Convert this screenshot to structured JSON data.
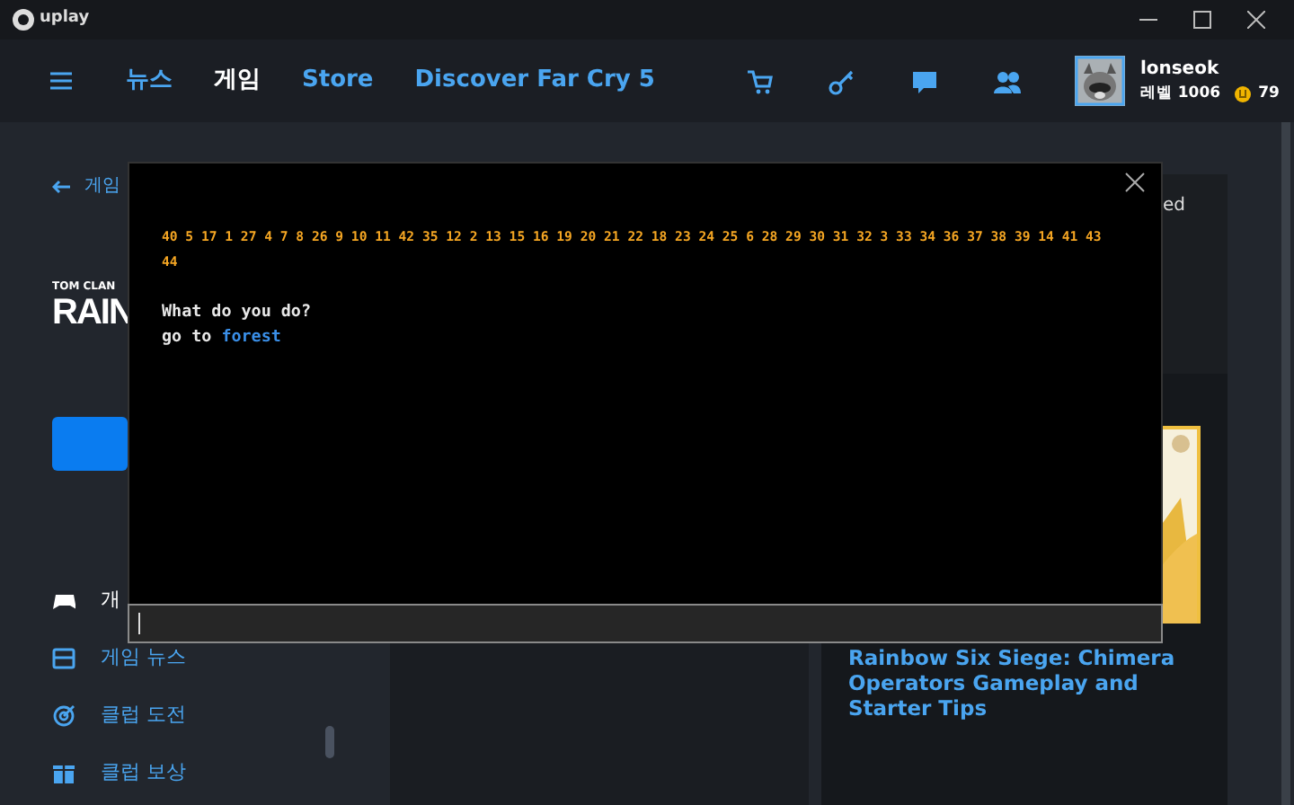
{
  "titlebar": {
    "logo": "uplay"
  },
  "nav": {
    "tabs": [
      {
        "label": "뉴스",
        "selected": false
      },
      {
        "label": "게임",
        "selected": true
      },
      {
        "label": "Store",
        "selected": false
      },
      {
        "label": "Discover Far Cry 5",
        "selected": false
      }
    ],
    "user": {
      "name": "lonseok",
      "level": "레벨 1006",
      "coins": "79"
    }
  },
  "sidebar": {
    "back": "게임",
    "logo_small": "TOM CLAN",
    "logo_big": "RAIN",
    "items": [
      {
        "label": "개",
        "selected": true
      },
      {
        "label": "게임 뉴스",
        "selected": false
      },
      {
        "label": "클럽 도전",
        "selected": false
      },
      {
        "label": "클럽 보상",
        "selected": false
      }
    ]
  },
  "right_panel": {
    "card_text": "ed",
    "article_title": "Rainbow Six Siege: Chimera Operators Gameplay and Starter Tips"
  },
  "console": {
    "output_lines": [
      "40 5 17 1 27 4 7 8 26 9 10 11 42 35 12 2 13 15 16 19 20 21 22 18 23 24 25 6 28 29 30 31 32 3 33 34 36 37 38 39 14 41 43",
      "44"
    ],
    "prompt": "What do you do?",
    "command": {
      "verb": "go to ",
      "target": "forest"
    }
  }
}
